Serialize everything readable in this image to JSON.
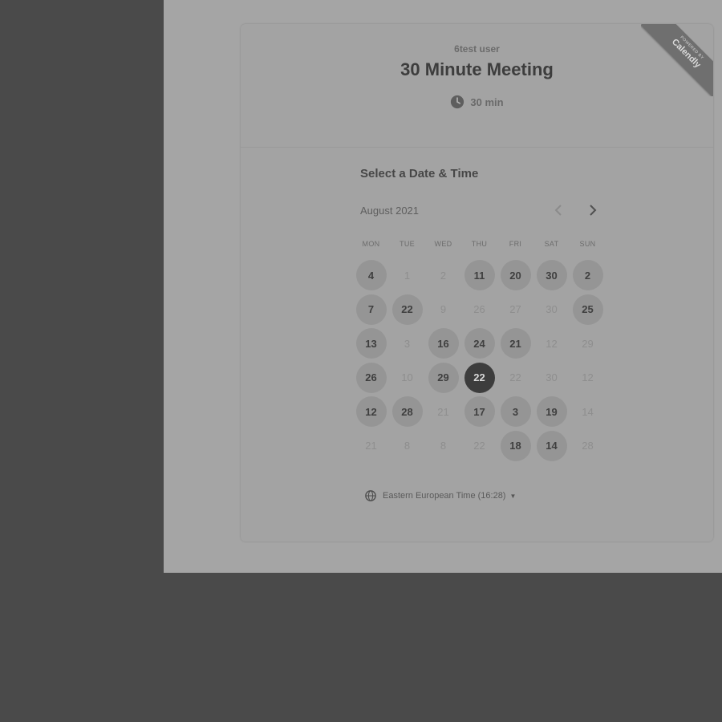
{
  "event": {
    "host": "6test user",
    "title": "30 Minute Meeting",
    "duration": "30 min"
  },
  "ribbon": {
    "small_text": "POWERED BY",
    "brand": "Calendly"
  },
  "picker": {
    "section_title": "Select a Date & Time",
    "month_label": "August 2021",
    "prev_icon": "chevron-left-icon",
    "next_icon": "chevron-right-icon",
    "weekdays": [
      "MON",
      "TUE",
      "WED",
      "THU",
      "FRI",
      "SAT",
      "SUN"
    ],
    "days": [
      {
        "label": "4",
        "state": "available"
      },
      {
        "label": "1",
        "state": "unavailable"
      },
      {
        "label": "2",
        "state": "unavailable"
      },
      {
        "label": "11",
        "state": "available"
      },
      {
        "label": "20",
        "state": "available"
      },
      {
        "label": "30",
        "state": "available"
      },
      {
        "label": "2",
        "state": "available"
      },
      {
        "label": "7",
        "state": "available"
      },
      {
        "label": "22",
        "state": "available"
      },
      {
        "label": "9",
        "state": "unavailable"
      },
      {
        "label": "26",
        "state": "unavailable"
      },
      {
        "label": "27",
        "state": "unavailable"
      },
      {
        "label": "30",
        "state": "unavailable"
      },
      {
        "label": "25",
        "state": "available"
      },
      {
        "label": "13",
        "state": "available"
      },
      {
        "label": "3",
        "state": "unavailable"
      },
      {
        "label": "16",
        "state": "available"
      },
      {
        "label": "24",
        "state": "available"
      },
      {
        "label": "21",
        "state": "available"
      },
      {
        "label": "12",
        "state": "unavailable"
      },
      {
        "label": "29",
        "state": "unavailable"
      },
      {
        "label": "26",
        "state": "available"
      },
      {
        "label": "10",
        "state": "unavailable"
      },
      {
        "label": "29",
        "state": "available"
      },
      {
        "label": "22",
        "state": "selected"
      },
      {
        "label": "22",
        "state": "unavailable"
      },
      {
        "label": "30",
        "state": "unavailable"
      },
      {
        "label": "12",
        "state": "unavailable"
      },
      {
        "label": "12",
        "state": "available"
      },
      {
        "label": "28",
        "state": "available"
      },
      {
        "label": "21",
        "state": "unavailable"
      },
      {
        "label": "17",
        "state": "available"
      },
      {
        "label": "3",
        "state": "available"
      },
      {
        "label": "19",
        "state": "available"
      },
      {
        "label": "14",
        "state": "unavailable"
      },
      {
        "label": "21",
        "state": "unavailable"
      },
      {
        "label": "8",
        "state": "unavailable"
      },
      {
        "label": "8",
        "state": "unavailable"
      },
      {
        "label": "22",
        "state": "unavailable"
      },
      {
        "label": "18",
        "state": "available"
      },
      {
        "label": "14",
        "state": "available"
      },
      {
        "label": "28",
        "state": "unavailable"
      }
    ],
    "timezone": "Eastern European Time (16:28)"
  }
}
